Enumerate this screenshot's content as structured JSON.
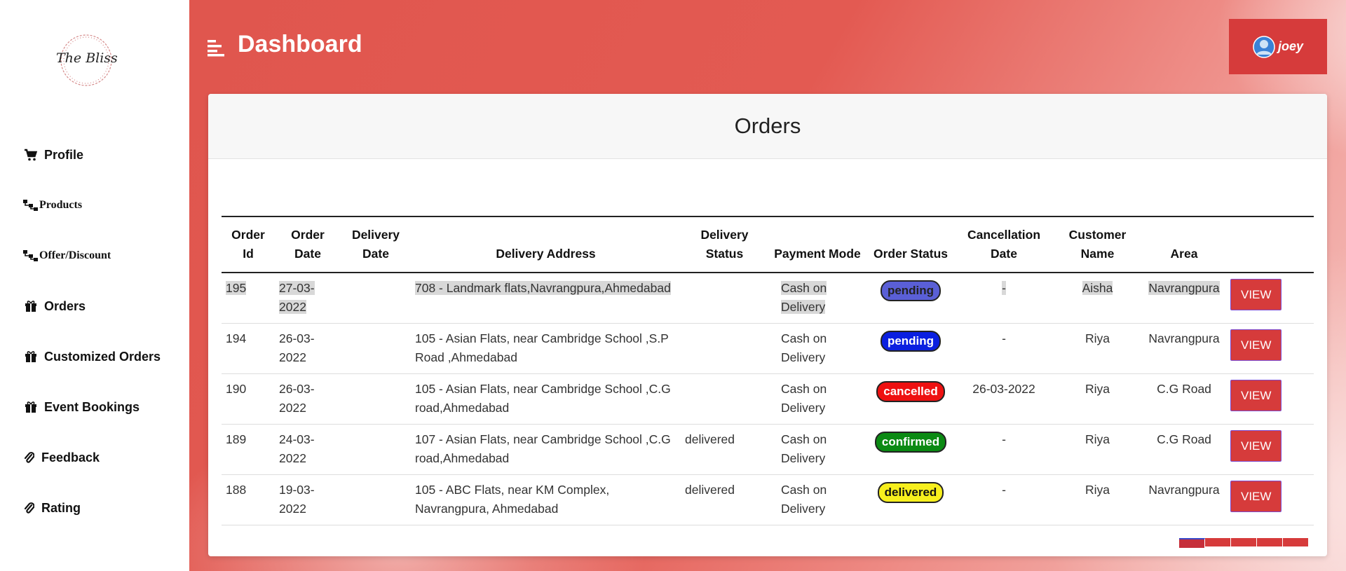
{
  "app": {
    "logo_text": "The Bliss",
    "page_title": "Dashboard",
    "user_name": "joey"
  },
  "sidebar": {
    "items": [
      {
        "label": "Profile",
        "icon": "cart-icon"
      },
      {
        "label": "Products",
        "icon": "sitemap-icon"
      },
      {
        "label": "Offer/Discount",
        "icon": "sitemap-icon"
      },
      {
        "label": "Orders",
        "icon": "gift-icon"
      },
      {
        "label": "Customized Orders",
        "icon": "gift-icon"
      },
      {
        "label": "Event Bookings",
        "icon": "gift-icon"
      },
      {
        "label": "Feedback",
        "icon": "paperclip-icon"
      },
      {
        "label": "Rating",
        "icon": "paperclip-icon"
      }
    ]
  },
  "orders": {
    "title": "Orders",
    "headers": [
      "Order Id",
      "Order Date",
      "Delivery Date",
      "Delivery Address",
      "Delivery Status",
      "Payment Mode",
      "Order Status",
      "Cancellation Date",
      "Customer Name",
      "Area",
      ""
    ],
    "view_label": "VIEW",
    "rows": [
      {
        "id": "195",
        "order_date": "27-03-2022",
        "delivery_date": "",
        "address": "708 - Landmark flats,Navrangpura,Ahmedabad",
        "delivery_status": "",
        "payment": "Cash on Delivery",
        "status": "pending",
        "cancellation": "-",
        "customer": "Aisha",
        "area": "Navrangpura"
      },
      {
        "id": "194",
        "order_date": "26-03-2022",
        "delivery_date": "",
        "address": "105 - Asian Flats, near Cambridge School ,S.P Road ,Ahmedabad",
        "delivery_status": "",
        "payment": "Cash on Delivery",
        "status": "pending",
        "cancellation": "-",
        "customer": "Riya",
        "area": "Navrangpura"
      },
      {
        "id": "190",
        "order_date": "26-03-2022",
        "delivery_date": "",
        "address": "105 - Asian Flats, near Cambridge School ,C.G road,Ahmedabad",
        "delivery_status": "",
        "payment": "Cash on Delivery",
        "status": "cancelled",
        "cancellation": "26-03-2022",
        "customer": "Riya",
        "area": "C.G Road"
      },
      {
        "id": "189",
        "order_date": "24-03-2022",
        "delivery_date": "",
        "address": "107 - Asian Flats, near Cambridge School ,C.G road,Ahmedabad",
        "delivery_status": "delivered",
        "payment": "Cash on Delivery",
        "status": "confirmed",
        "cancellation": "-",
        "customer": "Riya",
        "area": "C.G Road"
      },
      {
        "id": "188",
        "order_date": "19-03-2022",
        "delivery_date": "",
        "address": "105 - ABC Flats, near KM Complex, Navrangpura, Ahmedabad",
        "delivery_status": "delivered",
        "payment": "Cash on Delivery",
        "status": "delivered",
        "cancellation": "-",
        "customer": "Riya",
        "area": "Navrangpura"
      }
    ]
  },
  "colors": {
    "accent": "#d63b3b",
    "pending": "#0a1fe0",
    "cancelled": "#ee1111",
    "confirmed": "#0b8a13",
    "delivered": "#f7ef1d"
  }
}
